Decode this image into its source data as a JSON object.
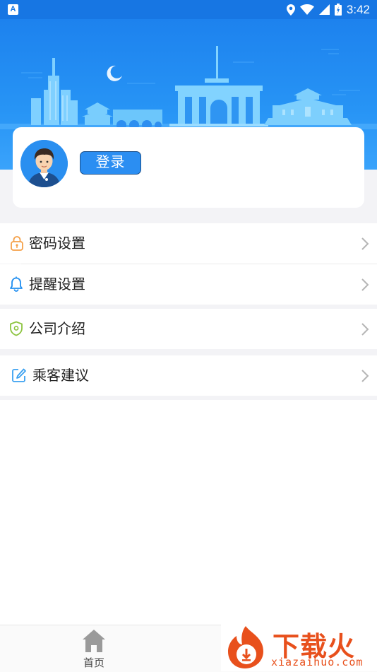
{
  "status_bar": {
    "time": "3:42",
    "app_icon": "A"
  },
  "profile": {
    "login_label": "登录"
  },
  "menu": [
    {
      "label": "密码设置",
      "icon": "lock-icon"
    },
    {
      "label": "提醒设置",
      "icon": "bell-icon"
    },
    {
      "label": "公司介绍",
      "icon": "shield-icon"
    },
    {
      "label": "乘客建议",
      "icon": "edit-icon"
    }
  ],
  "bottom_nav": {
    "home_label": "首页"
  },
  "watermark": {
    "brand": "下载火",
    "url": "xiazaihuo.com"
  },
  "colors": {
    "primary": "#1d82ee",
    "accent_orange": "#e8501c"
  }
}
